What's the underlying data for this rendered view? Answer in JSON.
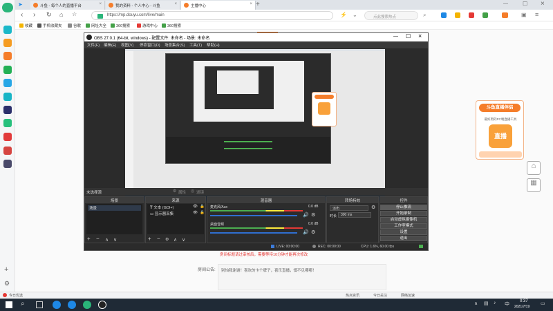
{
  "browser": {
    "tabs": [
      {
        "label": "斗鱼 - 每个人的直播平台"
      },
      {
        "label": "我的资料 - 个人中心 - 斗鱼"
      },
      {
        "label": "主播中心"
      }
    ],
    "url": "https://mp.douyu.com/live/main",
    "search_placeholder": "点此搜索热点",
    "bookmarks": [
      "收藏",
      "手机收藏夹",
      "谷歌",
      "网址大全",
      "360搜索",
      "游戏中心",
      "360搜索"
    ]
  },
  "obs": {
    "title": "OBS 27.0.1 (64-bit, windows) - 配置文件: 未命名 - 场景: 未命名",
    "menu": [
      "文件(F)",
      "编辑(E)",
      "视图(V)",
      "停靠窗口(D)",
      "场景集合(S)",
      "工具(T)",
      "帮助(H)"
    ],
    "no_source_selected": "未选择源",
    "properties_label": "属性",
    "filters_label": "滤镜",
    "scenes_header": "场景",
    "scene_item": "场景",
    "sources_header": "来源",
    "sources": [
      "文本 (GDI+)",
      "显示器采集"
    ],
    "mixer_header": "混音器",
    "mixer_channels": [
      {
        "name": "麦克风/Aux",
        "db": "0.0 dB"
      },
      {
        "name": "桌面音频",
        "db": "0.0 dB"
      }
    ],
    "transitions_header": "转场特效",
    "transition_type": "淡出",
    "duration_label": "时长",
    "duration_value": "300 ms",
    "controls_header": "控件",
    "controls": [
      "停止推流",
      "开始录制",
      "启动虚拟摄像机",
      "工作室模式",
      "设置",
      "退出"
    ],
    "status": {
      "live": "LIVE: 00:00:00",
      "rec": "REC: 00:00:00",
      "cpu": "CPU: 1.6%, 60.00 fps"
    }
  },
  "page": {
    "notice_text": "房间标题请过审核后，需要等待10分钟才能再次修改",
    "announcement_label": "房间公告:",
    "announcement_text": "别怕我谢谢！喜欢的卡个牌子，喜乐直播，慎不见哪哪！"
  },
  "ad": {
    "title": "斗鱼直播伴侣",
    "subtitle": "最好用的PC端直播工具",
    "badge": "直播"
  },
  "browser_status": {
    "left": "今日优选",
    "items": [
      "热点资讯",
      "今日关注",
      "网络加速"
    ]
  },
  "taskbar": {
    "time": "0:37",
    "date": "2021/7/19"
  },
  "colors": {
    "accent": "#f57d2a",
    "obs_bg": "#2b2b2b",
    "taskbar": "#1f2a36"
  }
}
